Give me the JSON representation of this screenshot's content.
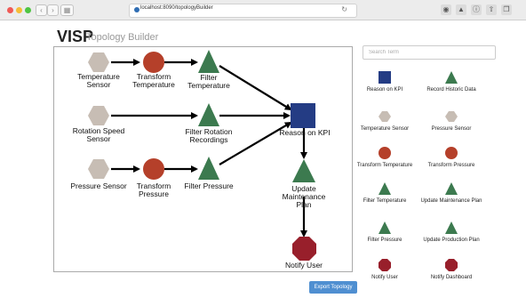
{
  "browser": {
    "url": "localhost:8090/topologyBuilder"
  },
  "header": {
    "title": "VISP",
    "subtitle": "Topology Builder"
  },
  "canvas_nodes": {
    "temperature_sensor": "Temperature Sensor",
    "transform_temperature": "Transform Temperature",
    "filter_temperature": "Filter Temperature",
    "rotation_speed_sensor": "Rotation Speed Sensor",
    "filter_rotation": "Filter Rotation Recordings",
    "reason_kpi": "Reason on KPI",
    "pressure_sensor": "Pressure Sensor",
    "transform_pressure": "Transform Pressure",
    "filter_pressure": "Filter Pressure",
    "update_maintenance": "Update Maintenance Plan",
    "notify_user": "Notify User"
  },
  "palette": {
    "search_placeholder": "Search Term",
    "items": [
      {
        "label": "Reason on KPI",
        "icon": "square-icon"
      },
      {
        "label": "Record Historic Data",
        "icon": "triangle-icon"
      },
      {
        "label": "Temperature Sensor",
        "icon": "hexagon-icon"
      },
      {
        "label": "Pressure Sensor",
        "icon": "hexagon-icon"
      },
      {
        "label": "Transform Temperature",
        "icon": "circle-icon"
      },
      {
        "label": "Transform Pressure",
        "icon": "circle-icon"
      },
      {
        "label": "Filter Temperature",
        "icon": "triangle-icon"
      },
      {
        "label": "Update Maintenance Plan",
        "icon": "triangle-icon"
      },
      {
        "label": "Filter Pressure",
        "icon": "triangle-icon"
      },
      {
        "label": "Update Production Plan",
        "icon": "triangle-icon"
      },
      {
        "label": "Notify User",
        "icon": "octagon-icon"
      },
      {
        "label": "Notify Dashboard",
        "icon": "octagon-icon"
      }
    ]
  },
  "actions": {
    "export_label": "Export Topology"
  },
  "colors": {
    "sensor": "#c7bdb4",
    "transform": "#b5402a",
    "filter": "#3c7a4f",
    "kpi": "#243c84",
    "notify": "#981f2b",
    "export": "#4f8fd1"
  }
}
